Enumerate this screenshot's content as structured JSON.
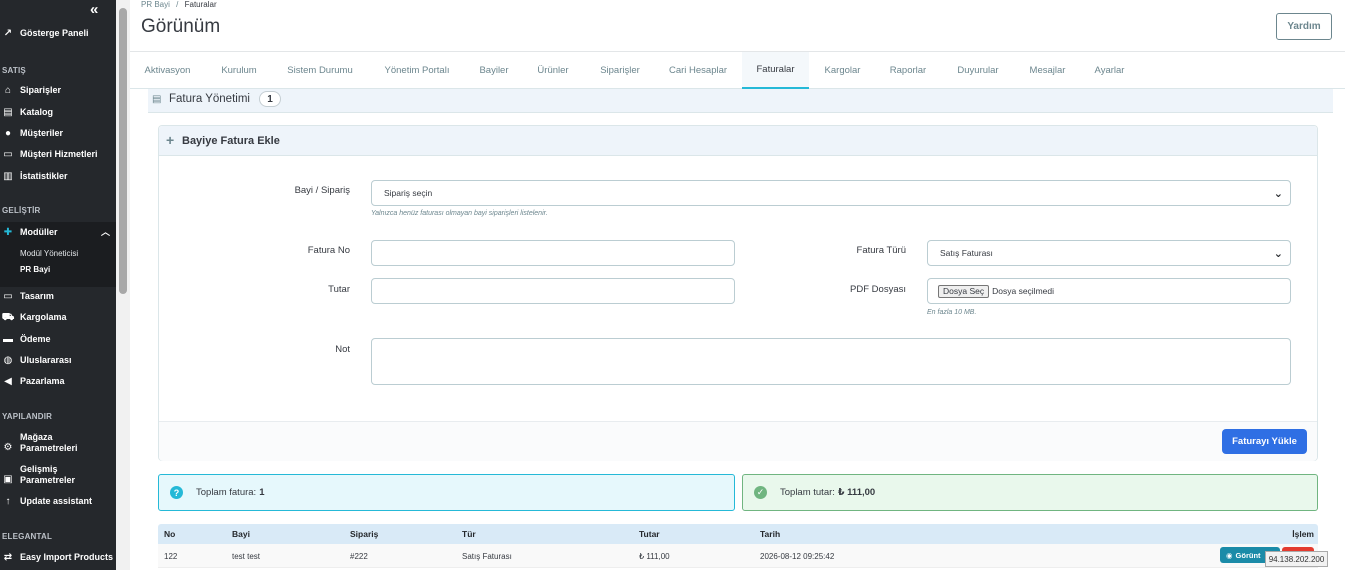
{
  "sidebar": {
    "dashboard": "Gösterge Paneli",
    "sections": {
      "satis": "SATIŞ",
      "gelistir": "GELİŞTİR",
      "yapilandir": "YAPILANDIR",
      "elegantal": "ELEGANTAL"
    },
    "items": {
      "siparisler": "Siparişler",
      "katalog": "Katalog",
      "musteriler": "Müşteriler",
      "musteri_hizmetleri": "Müşteri Hizmetleri",
      "istatistikler": "İstatistikler",
      "moduller": "Modüller",
      "modul_yoneticisi": "Modül Yöneticisi",
      "pr_bayi": "PR Bayi",
      "tasarim": "Tasarım",
      "kargolama": "Kargolama",
      "odeme": "Ödeme",
      "uluslararasi": "Uluslararası",
      "pazarlama": "Pazarlama",
      "magaza_1": "Mağaza",
      "magaza_2": "Parametreleri",
      "gelismis_1": "Gelişmiş",
      "gelismis_2": "Parametreler",
      "update_assistant": "Update assistant",
      "easy_import": "Easy Import Products"
    }
  },
  "header": {
    "breadcrumb_parent": "PR Bayi",
    "breadcrumb_sep": "/",
    "breadcrumb_current": "Faturalar",
    "title": "Görünüm",
    "help": "Yardım"
  },
  "tabs": [
    "Aktivasyon",
    "Kurulum",
    "Sistem Durumu",
    "Yönetim Portalı",
    "Bayiler",
    "Ürünler",
    "Siparişler",
    "Cari Hesaplar",
    "Faturalar",
    "Kargolar",
    "Raporlar",
    "Duyurular",
    "Mesajlar",
    "Ayarlar"
  ],
  "panel": {
    "title": "Fatura Yönetimi",
    "count": "1"
  },
  "form": {
    "title": "Bayiye Fatura Ekle",
    "order_label": "Bayi / Sipariş",
    "order_value": "Sipariş seçin",
    "order_hint": "Yalnızca henüz faturası olmayan bayi siparişleri listelenir.",
    "invoice_no_label": "Fatura No",
    "invoice_no_value": "",
    "invoice_type_label": "Fatura Türü",
    "invoice_type_value": "Satış Faturası",
    "amount_label": "Tutar",
    "amount_value": "",
    "pdf_label": "PDF Dosyası",
    "file_button": "Dosya Seç",
    "file_status": "Dosya seçilmedi",
    "pdf_hint": "En fazla 10 MB.",
    "note_label": "Not",
    "note_value": "",
    "submit": "Faturayı Yükle"
  },
  "stats": {
    "total_invoice_label": "Toplam fatura:",
    "total_invoice_value": "1",
    "total_amount_label": "Toplam tutar:",
    "total_amount_value": "₺ 111,00"
  },
  "table": {
    "headers": [
      "No",
      "Bayi",
      "Sipariş",
      "Tür",
      "Tutar",
      "Tarih",
      "İşlem"
    ],
    "rows": [
      {
        "no": "122",
        "bayi": "test test",
        "siparis": "#222",
        "tur": "Satış Faturası",
        "tutar": "₺ 111,00",
        "tarih": "2026-08-12 09:25:42",
        "view": "Görünt"
      }
    ]
  },
  "tooltip": {
    "ip": "94.138.202.200"
  }
}
